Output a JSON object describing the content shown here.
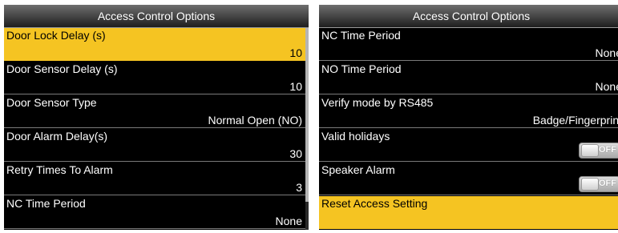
{
  "left": {
    "title": "Access Control Options",
    "items": [
      {
        "label": "Door Lock Delay (s)",
        "value": "10"
      },
      {
        "label": "Door Sensor Delay (s)",
        "value": "10"
      },
      {
        "label": "Door Sensor Type",
        "value": "Normal Open (NO)"
      },
      {
        "label": "Door Alarm Delay(s)",
        "value": "30"
      },
      {
        "label": "Retry Times To Alarm",
        "value": "3"
      },
      {
        "label": "NC Time Period",
        "value": "None"
      }
    ],
    "selected_index": 0
  },
  "right": {
    "title": "Access Control Options",
    "items": [
      {
        "label": "NC Time Period",
        "value": "None"
      },
      {
        "label": "NO Time Period",
        "value": "None"
      },
      {
        "label": "Verify mode by RS485",
        "value": "Badge/Fingerprint"
      },
      {
        "label": "Valid holidays",
        "toggle": "OFF"
      },
      {
        "label": "Speaker Alarm",
        "toggle": "OFF"
      },
      {
        "label": "Reset Access Setting"
      }
    ],
    "selected_index": 5
  },
  "colors": {
    "highlight": "#f5c422",
    "background": "#000000",
    "text": "#ffffff"
  }
}
